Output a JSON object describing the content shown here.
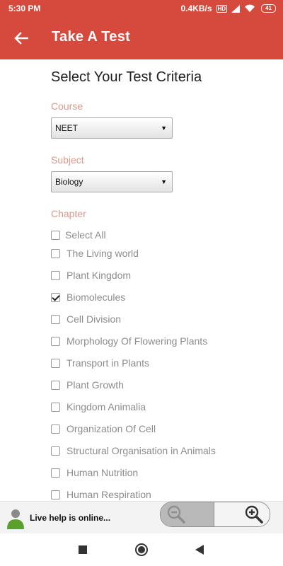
{
  "status_bar": {
    "time": "5:30 PM",
    "network_speed": "0.4KB/s",
    "sim_indicator": "HD",
    "battery": "41",
    "icons": [
      "sim-hd-icon",
      "signal-icon",
      "wifi-icon",
      "battery-icon"
    ]
  },
  "app_bar": {
    "title": "Take A Test",
    "back_icon": "arrow-left-icon",
    "background": "#d64a3d"
  },
  "page": {
    "title": "Select Your Test Criteria"
  },
  "form": {
    "course": {
      "label": "Course",
      "value": "NEET"
    },
    "subject": {
      "label": "Subject",
      "value": "Biology"
    },
    "chapter_label": "Chapter"
  },
  "chapters": [
    {
      "label": "Select All",
      "checked": false
    },
    {
      "label": "The Living world",
      "checked": false
    },
    {
      "label": "Plant Kingdom",
      "checked": false
    },
    {
      "label": "Biomolecules",
      "checked": true
    },
    {
      "label": "Cell Division",
      "checked": false
    },
    {
      "label": "Morphology Of Flowering Plants",
      "checked": false
    },
    {
      "label": "Transport in Plants",
      "checked": false
    },
    {
      "label": "Plant Growth",
      "checked": false
    },
    {
      "label": "Kingdom Animalia",
      "checked": false
    },
    {
      "label": "Organization Of Cell",
      "checked": false
    },
    {
      "label": "Structural Organisation in Animals",
      "checked": false
    },
    {
      "label": "Human Nutrition",
      "checked": false
    },
    {
      "label": "Human Respiration",
      "checked": false
    }
  ],
  "live_help": {
    "text": "Live help is online...",
    "zoom_out_icon": "zoom-out-icon",
    "zoom_in_icon": "zoom-in-icon"
  },
  "nav_bar": {
    "icons": [
      "recents-square-icon",
      "home-circle-icon",
      "back-triangle-icon"
    ]
  }
}
